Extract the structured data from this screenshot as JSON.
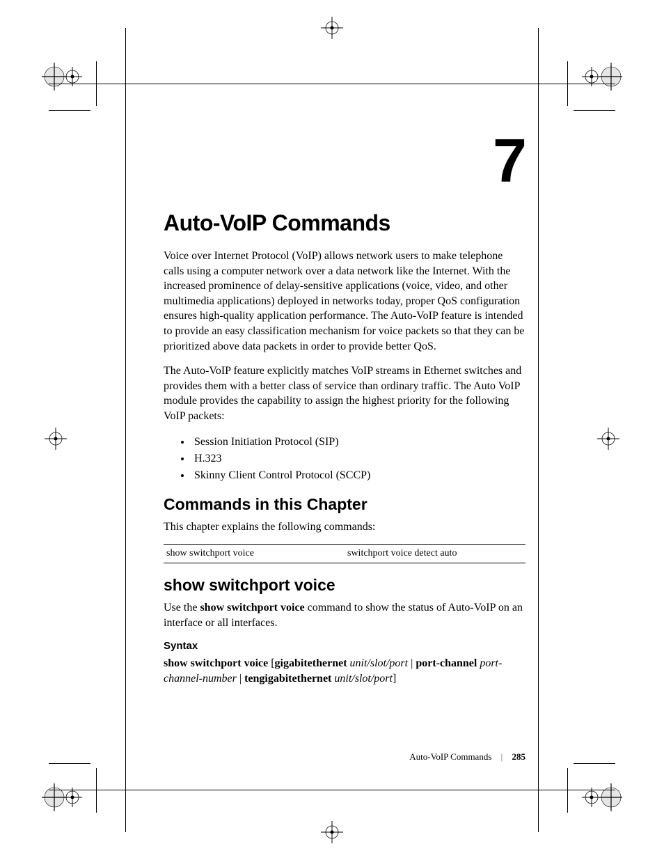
{
  "chapter": {
    "number": "7",
    "title": "Auto-VoIP Commands"
  },
  "intro_p1": "Voice over Internet Protocol (VoIP) allows network users to make telephone calls using a computer network over a data network like the Internet. With the increased prominence of delay-sensitive applications (voice, video, and other multimedia applications) deployed in networks today, proper QoS configuration ensures high-quality application performance. The Auto-VoIP feature is intended to provide an easy classification mechanism for voice packets so that they can be prioritized above data packets in order to provide better QoS.",
  "intro_p2": "The Auto-VoIP feature explicitly matches VoIP streams in Ethernet switches and provides them with a better class of service than ordinary traffic. The Auto VoIP module provides the capability to assign the highest priority for the following VoIP packets:",
  "bullets": [
    "Session Initiation Protocol (SIP)",
    "H.323",
    "Skinny Client Control Protocol (SCCP)"
  ],
  "commands_section": {
    "heading": "Commands in this Chapter",
    "lead": "This chapter explains the following commands:",
    "rows": [
      {
        "left": "show switchport voice",
        "right": "switchport voice detect auto"
      }
    ]
  },
  "show_switchport": {
    "heading": "show switchport voice",
    "desc_pre": "Use the ",
    "desc_bold": "show switchport voice",
    "desc_post": " command to show the status of Auto-VoIP on an interface or all interfaces.",
    "syntax_heading": "Syntax",
    "syntax_parts": {
      "cmd": "show switchport voice",
      "bracket_open": " [",
      "kw1": "gigabitethernet",
      "arg1": "unit/slot/port",
      "sep1": " | ",
      "kw2": "port-channel",
      "arg2": "port-channel-number",
      "sep2": " | ",
      "kw3": "tengigabitethernet",
      "arg3": "unit/slot/port",
      "bracket_close": "]"
    }
  },
  "footer": {
    "label": "Auto-VoIP Commands",
    "page": "285"
  }
}
